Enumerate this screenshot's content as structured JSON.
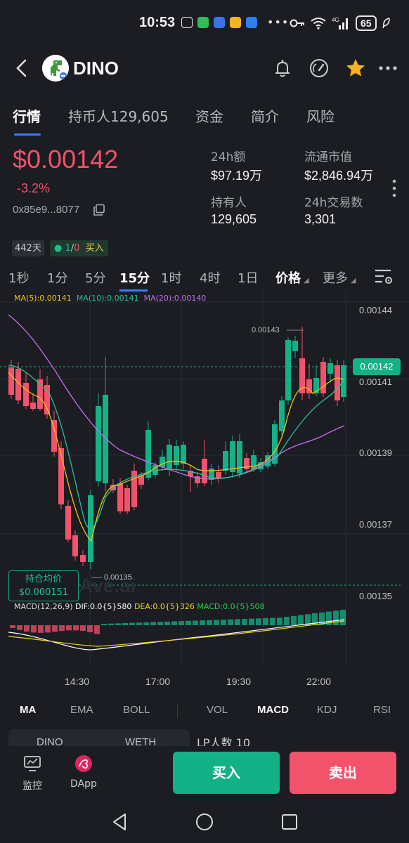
{
  "status_bar": {
    "time": "10:53",
    "battery": "65",
    "network": "4G"
  },
  "header": {
    "token_name": "DINO"
  },
  "tabs": [
    {
      "label": "行情",
      "active": true
    },
    {
      "label": "持币人129,605",
      "active": false
    },
    {
      "label": "资金",
      "active": false
    },
    {
      "label": "简介",
      "active": false
    },
    {
      "label": "风险",
      "active": false
    }
  ],
  "price": {
    "value": "$0.00142",
    "change": "-3.2%",
    "address": "0x85e9...8077"
  },
  "stats": {
    "vol24_label": "24h额",
    "vol24": "$97.19万",
    "mcap_label": "流通市值",
    "mcap": "$2,846.94万",
    "holders_label": "持有人",
    "holders": "129,605",
    "tx24_label": "24h交易数",
    "tx24": "3,301"
  },
  "tags": {
    "age": "442天",
    "ratio_a": "1",
    "ratio_sep": "/",
    "ratio_b": "0",
    "action": "买入"
  },
  "intervals": [
    "1秒",
    "1分",
    "5分",
    "15分",
    "1时",
    "4时",
    "1日"
  ],
  "interval_active": "15分",
  "interval_extra": {
    "price": "价格",
    "more": "更多"
  },
  "chart": {
    "ma_legend": {
      "ma5": "MA(5):0.00141",
      "ma10": "MA(10):0.00141",
      "ma20": "MA(20):0.00140"
    },
    "y_labels": [
      "0.00144",
      "0.00141",
      "0.00139",
      "0.00137",
      "0.00135"
    ],
    "current_price_tag": "0.00142",
    "high_annotation": "0.00143",
    "low_annotation": "0.00135",
    "avg_cost_label": "持仓均价",
    "avg_cost_value": "$0.000151",
    "watermark": "Ave.ai",
    "macd_legend": {
      "title": "MACD(12,26,9)",
      "dif": "DIF:0.0{5}580",
      "dea": "DEA:0.0{5}326",
      "macd": "MACD:0.0{5}508"
    },
    "x_labels": [
      "14:30",
      "17:00",
      "19:30",
      "22:00"
    ],
    "colors": {
      "up": "#14b187",
      "down": "#f2526a",
      "ma5": "#f0c419",
      "ma10": "#25c29a",
      "ma20": "#c66cf0"
    }
  },
  "indicator_tabs": [
    "MA",
    "EMA",
    "BOLL",
    "VOL",
    "MACD",
    "KDJ",
    "RSI"
  ],
  "indicator_active": [
    "MA",
    "MACD"
  ],
  "lp": {
    "pair_a": "DINO",
    "pair_b": "WETH",
    "count_label": "LP人数",
    "count": "10"
  },
  "bottom_bar": {
    "monitor": "监控",
    "dapp": "DApp",
    "buy": "买入",
    "sell": "卖出"
  }
}
